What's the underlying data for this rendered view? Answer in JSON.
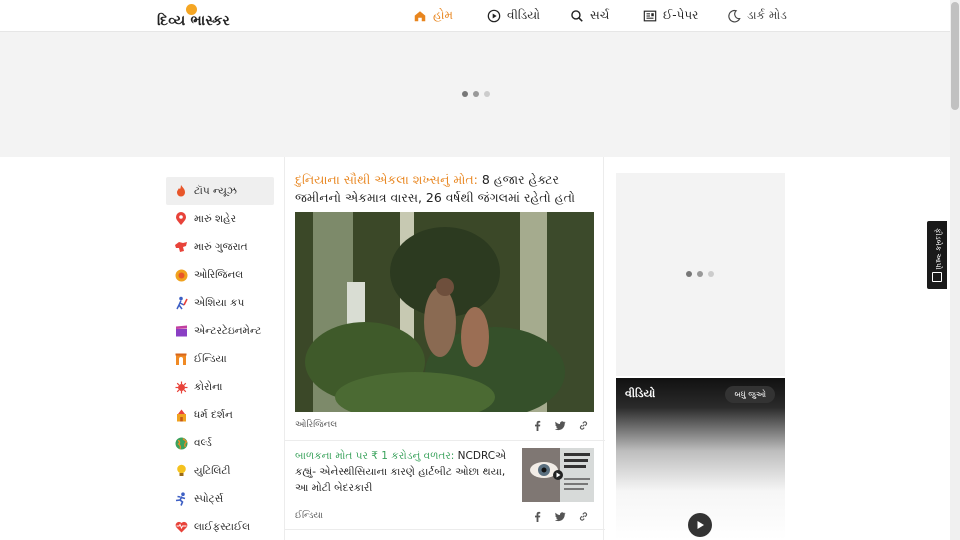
{
  "header": {
    "logo_text": "દિવ્ય ભાસ્કર",
    "nav": [
      {
        "label": "હોમ",
        "icon": "home-icon",
        "active": true
      },
      {
        "label": "વીડિયો",
        "icon": "play-circle-icon",
        "active": false
      },
      {
        "label": "સર્ચ",
        "icon": "search-icon",
        "active": false
      },
      {
        "label": "ઈ-પેપર",
        "icon": "newspaper-icon",
        "active": false
      },
      {
        "label": "ડાર્ક મોડ",
        "icon": "moon-icon",
        "active": false
      }
    ]
  },
  "sidebar": {
    "items": [
      {
        "label": "ટૉપ ન્યૂઝ",
        "icon": "flame-icon",
        "active": true
      },
      {
        "label": "મારું શહેર",
        "icon": "location-pin-icon"
      },
      {
        "label": "મારું ગુજરાત",
        "icon": "gujarat-map-icon"
      },
      {
        "label": "ઓરિજિનલ",
        "icon": "original-badge-icon"
      },
      {
        "label": "એશિયા કપ",
        "icon": "cricket-icon"
      },
      {
        "label": "એન્ટરટેઇનમેન્ટ",
        "icon": "clapperboard-icon"
      },
      {
        "label": "ઈન્ડિયા",
        "icon": "india-gate-icon"
      },
      {
        "label": "કોરોના",
        "icon": "virus-icon"
      },
      {
        "label": "ધર્મ દર્શન",
        "icon": "temple-icon"
      },
      {
        "label": "વર્લ્ડ",
        "icon": "globe-icon"
      },
      {
        "label": "યુટિલિટી",
        "icon": "bulb-icon"
      },
      {
        "label": "સ્પોર્ટ્સ",
        "icon": "runner-icon"
      },
      {
        "label": "લાઈફસ્ટાઈલ",
        "icon": "heart-icon"
      }
    ]
  },
  "feed": {
    "lead": {
      "highlight": "દુનિયાના સૌથી એકલા શખ્સનું મોત:",
      "title": " 8 હજાર હેક્ટર જમીનનો એકમાત્ર વારસ, 26 વર્ષથી જંગલમાં રહેતો હતો ગુમનામ",
      "tag": "ઓરિજિનલ"
    },
    "second": {
      "highlight": "બાળકના મોત પર ₹ 1 કરોડનું વળતર:",
      "title": " NCDRCએ કહ્યું- એનેસ્થીસિયાના કારણે હાર્ટબીટ ઓછા થયા, આ મોટી બેદરકારી",
      "tag": "ઈન્ડિયા"
    }
  },
  "video_widget": {
    "title": "વીડિયો",
    "button_label": "બધું જુઓ"
  },
  "floating_tab": {
    "label": "ફીડબેક આપો"
  },
  "colors": {
    "accent": "#e8851e",
    "green_highlight": "#3aa25c",
    "logo_dot": "#f5a623"
  }
}
